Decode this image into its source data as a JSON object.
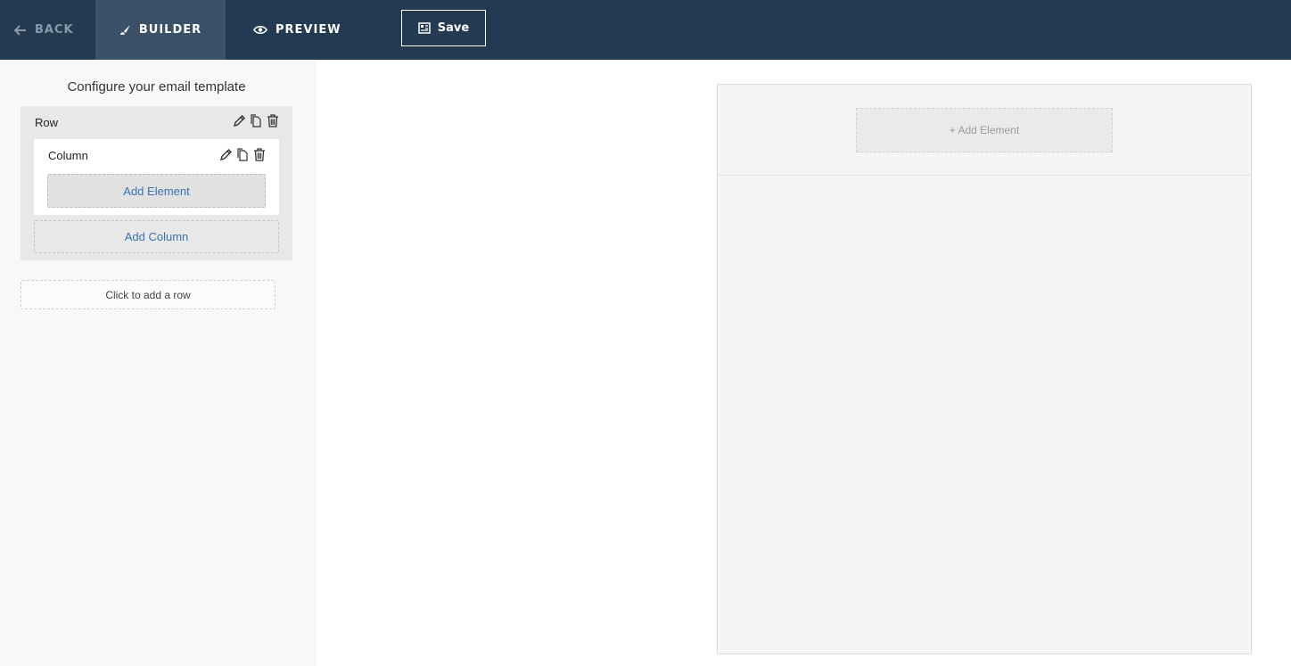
{
  "nav": {
    "back_label": "Back",
    "builder_label": "Builder",
    "preview_label": "Preview",
    "save_label": "Save",
    "active_tab": "builder"
  },
  "sidebar": {
    "title": "Configure your email template",
    "row": {
      "label": "Row",
      "column": {
        "label": "Column",
        "add_element_label": "Add Element"
      },
      "add_column_label": "Add Column"
    },
    "add_row_label": "Click to add a row"
  },
  "canvas": {
    "add_element_label": "+ Add Element"
  },
  "icons": {
    "back": "arrow-left-icon",
    "builder": "brush-icon",
    "preview": "eye-icon",
    "save": "save-icon",
    "edit": "pencil-icon",
    "duplicate": "copy-icon",
    "delete": "trash-icon"
  },
  "colors": {
    "topbar": "#233a52",
    "active_tab": "#3a5168",
    "link": "#3a73b0",
    "sidebar_bg": "#f8f8f8"
  }
}
